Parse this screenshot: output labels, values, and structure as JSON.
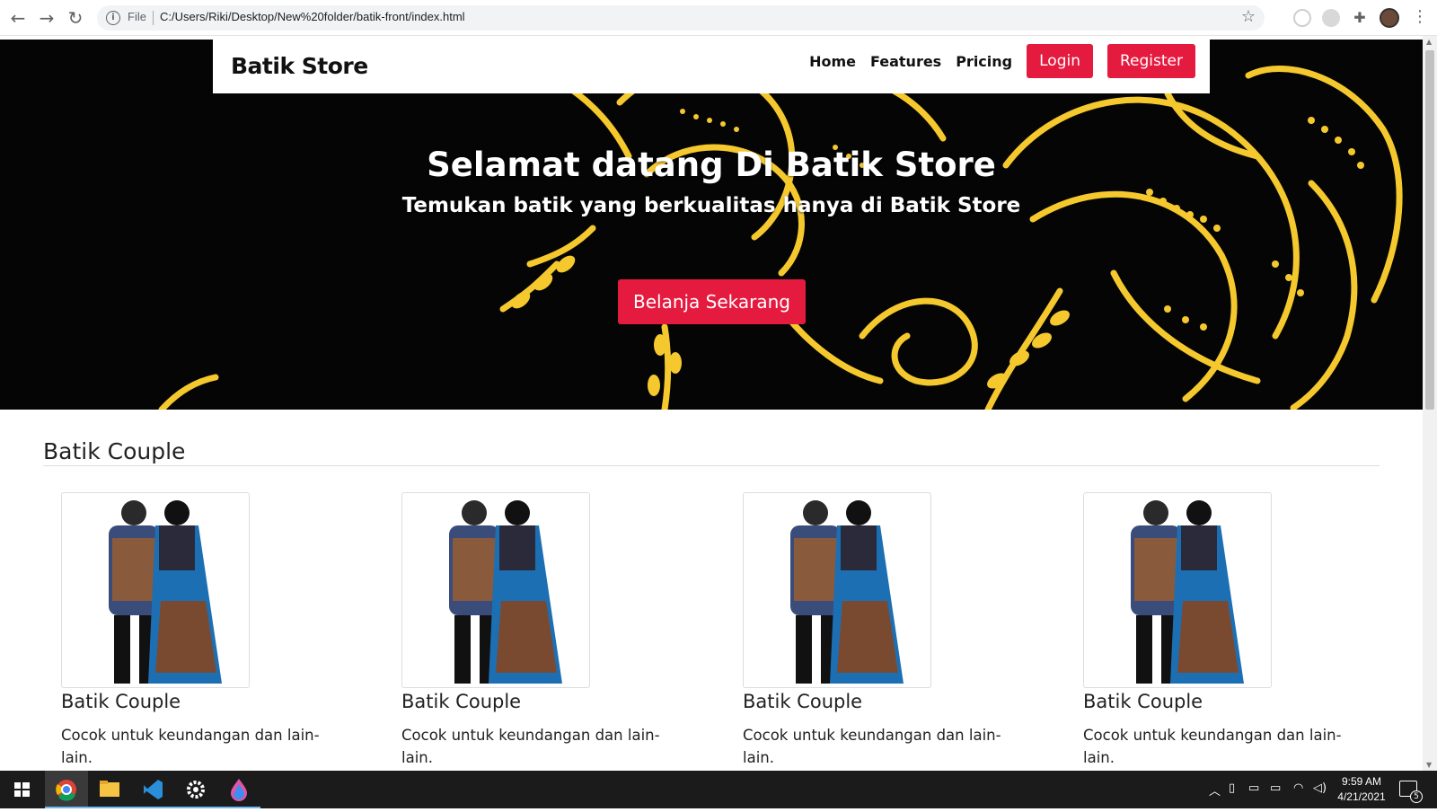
{
  "browser": {
    "url_prefix": "File",
    "url": "C:/Users/Riki/Desktop/New%20folder/batik-front/index.html",
    "icons": [
      "back-icon",
      "forward-icon",
      "reload-icon",
      "info-icon",
      "star-icon",
      "extension-icon",
      "puzzle-icon",
      "profile-avatar",
      "menu-icon"
    ]
  },
  "navbar": {
    "brand": "Batik Store",
    "links": [
      "Home",
      "Features",
      "Pricing"
    ],
    "login": "Login",
    "register": "Register"
  },
  "hero": {
    "title": "Selamat datang Di Batik Store",
    "subtitle": "Temukan batik yang berkualitas hanya di Batik Store",
    "cta": "Belanja Sekarang"
  },
  "section": {
    "title": "Batik Couple"
  },
  "products": [
    {
      "title": "Batik Couple",
      "desc": "Cocok untuk keundangan dan lain-lain."
    },
    {
      "title": "Batik Couple",
      "desc": "Cocok untuk keundangan dan lain-lain."
    },
    {
      "title": "Batik Couple",
      "desc": "Cocok untuk keundangan dan lain-lain."
    },
    {
      "title": "Batik Couple",
      "desc": "Cocok untuk keundangan dan lain-lain."
    }
  ],
  "taskbar": {
    "time": "9:59 AM",
    "date": "4/21/2021",
    "notification_count": "5"
  },
  "colors": {
    "accent": "#e51a3f",
    "hero_bg": "#050505",
    "batik_gold": "#f5c92e"
  }
}
